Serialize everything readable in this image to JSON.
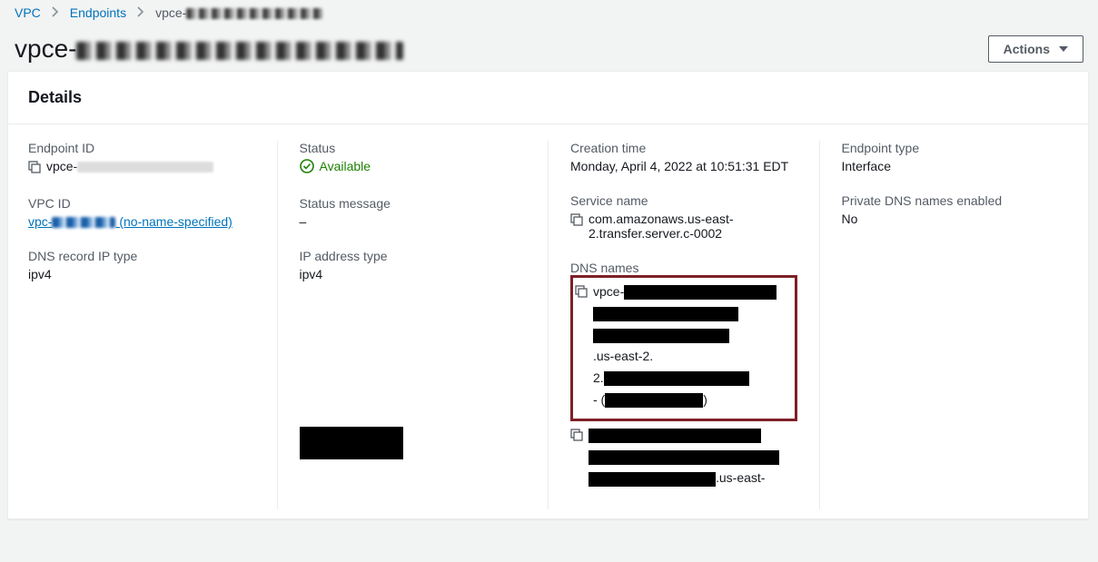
{
  "breadcrumb": {
    "vpc": "VPC",
    "endpoints": "Endpoints",
    "current_prefix": "vpce-"
  },
  "header": {
    "title_prefix": "vpce-",
    "actions_label": "Actions"
  },
  "panel": {
    "title": "Details"
  },
  "col1": {
    "endpoint_id_label": "Endpoint ID",
    "endpoint_id_prefix": "vpce-",
    "vpc_id_label": "VPC ID",
    "vpc_id_prefix": "vpc-",
    "vpc_id_suffix": " (no-name-specified)",
    "dns_record_ip_type_label": "DNS record IP type",
    "dns_record_ip_type_value": "ipv4"
  },
  "col2": {
    "status_label": "Status",
    "status_value": "Available",
    "status_message_label": "Status message",
    "status_message_value": "–",
    "ip_address_type_label": "IP address type",
    "ip_address_type_value": "ipv4"
  },
  "col3": {
    "creation_time_label": "Creation time",
    "creation_time_value": "Monday, April 4, 2022 at 10:51:31 EDT",
    "service_name_label": "Service name",
    "service_name_value": "com.amazonaws.us-east-2.transfer.server.c-0002",
    "dns_names_label": "DNS names",
    "dns1_prefix": "vpce-",
    "dns1_mid": ".us-east-2.",
    "dns1_suffix_open": "- (",
    "dns1_suffix_close": ")",
    "dns2_suffix": ".us-east-"
  },
  "col4": {
    "endpoint_type_label": "Endpoint type",
    "endpoint_type_value": "Interface",
    "private_dns_label": "Private DNS names enabled",
    "private_dns_value": "No"
  }
}
